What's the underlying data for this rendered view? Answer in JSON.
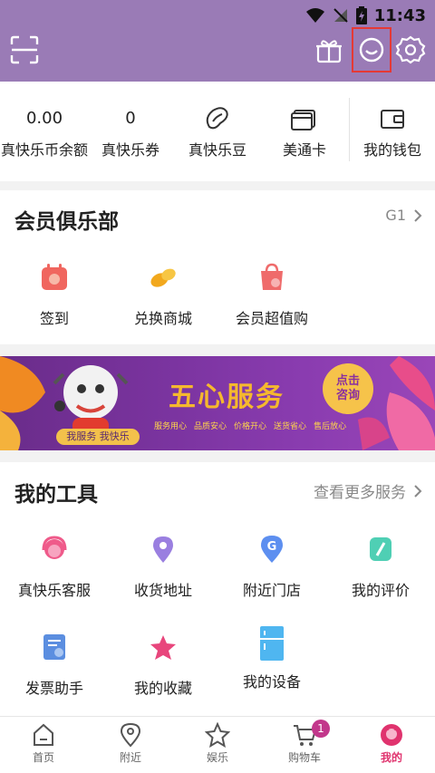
{
  "status_bar": {
    "time": "11:43"
  },
  "wallet": [
    {
      "value": "0.00",
      "label": "真快乐币余额"
    },
    {
      "value": "0",
      "label": "真快乐券"
    },
    {
      "icon": "bean-icon",
      "label": "真快乐豆"
    },
    {
      "icon": "card-icon",
      "label": "美通卡"
    },
    {
      "icon": "wallet-icon",
      "label": "我的钱包"
    }
  ],
  "club": {
    "title": "会员俱乐部",
    "level": "G1",
    "items": [
      {
        "icon": "calendar-icon",
        "label": "签到"
      },
      {
        "icon": "beans-icon",
        "label": "兑换商城"
      },
      {
        "icon": "bag-icon",
        "label": "会员超值购"
      }
    ]
  },
  "banner": {
    "title": "五心服务",
    "button_line1": "点击",
    "button_line2": "咨询",
    "slogan": "我服务 我快乐",
    "tags": [
      "服务用心",
      "品质安心",
      "价格开心",
      "送货省心",
      "售后放心"
    ]
  },
  "tools": {
    "title": "我的工具",
    "more": "查看更多服务",
    "items": [
      {
        "icon": "headset-icon",
        "label": "真快乐客服"
      },
      {
        "icon": "location-pin-icon",
        "label": "收货地址"
      },
      {
        "icon": "store-pin-icon",
        "label": "附近门店"
      },
      {
        "icon": "pen-icon",
        "label": "我的评价"
      },
      {
        "icon": "invoice-icon",
        "label": "发票助手"
      },
      {
        "icon": "star-icon",
        "label": "我的收藏"
      },
      {
        "icon": "fridge-icon",
        "label": "我的设备"
      }
    ]
  },
  "tabbar": {
    "cart_badge": "1",
    "tabs": [
      {
        "icon": "home-icon",
        "label": "首页"
      },
      {
        "icon": "nearby-pin-icon",
        "label": "附近"
      },
      {
        "icon": "star-outline-icon",
        "label": "娱乐"
      },
      {
        "icon": "cart-icon",
        "label": "购物车"
      },
      {
        "icon": "profile-icon",
        "label": "我的"
      }
    ]
  },
  "colors": {
    "header": "#9a7bb6",
    "accent_pink": "#e0336e",
    "highlight_box": "#e53935"
  }
}
